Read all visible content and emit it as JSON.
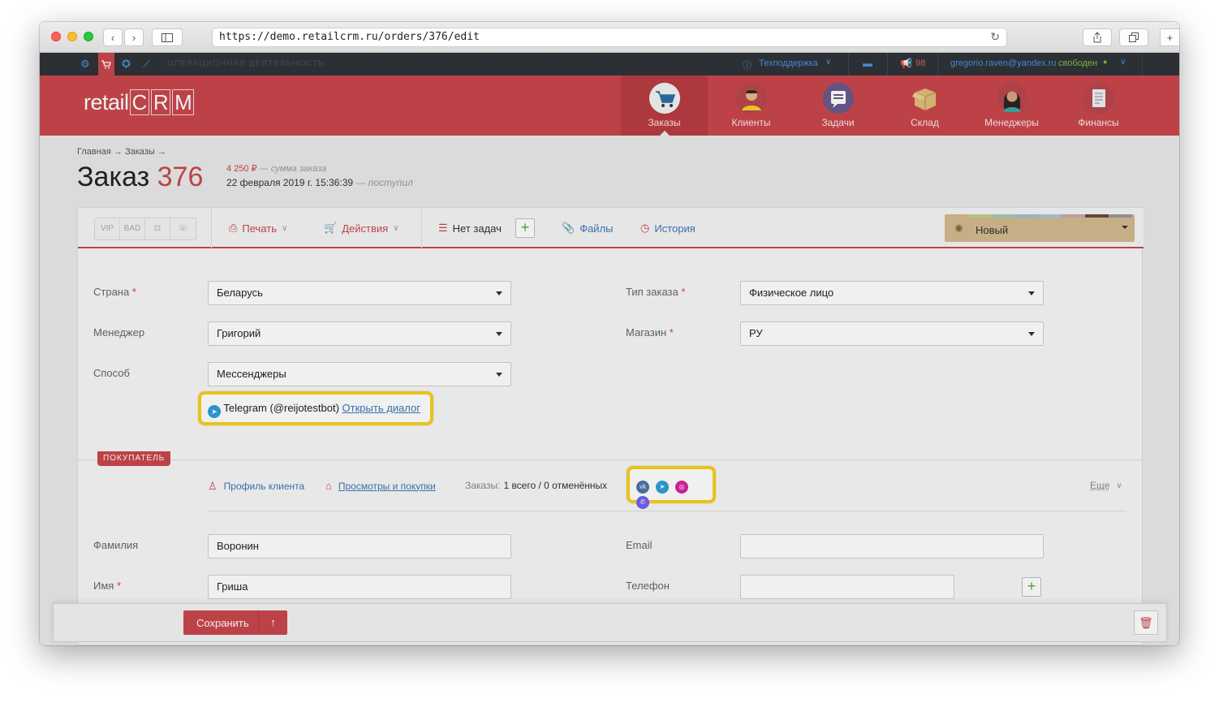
{
  "browser": {
    "url": "https://demo.retailcrm.ru/orders/376/edit",
    "back": "‹",
    "forward": "›"
  },
  "topbar": {
    "section": "ОПЕРАЦИОННАЯ ДЕЯТЕЛЬНОСТЬ",
    "support": "Техподдержка",
    "notifications": "98",
    "user_email": "gregorio.raven@yandex.ru",
    "user_status": "свободен"
  },
  "header": {
    "logo_prefix": "retail",
    "logo_letters": [
      "C",
      "R",
      "M"
    ],
    "nav": [
      {
        "label": "Заказы",
        "icon": "cart-icon"
      },
      {
        "label": "Клиенты",
        "icon": "client-avatar-icon"
      },
      {
        "label": "Задачи",
        "icon": "tasks-icon"
      },
      {
        "label": "Склад",
        "icon": "warehouse-box-icon"
      },
      {
        "label": "Менеджеры",
        "icon": "manager-avatar-icon"
      },
      {
        "label": "Финансы",
        "icon": "finance-icon"
      }
    ]
  },
  "breadcrumb": "Главная → Заказы →",
  "order": {
    "title_prefix": "Заказ",
    "number": "376",
    "sum": "4 250 ₽",
    "sum_label": "— сумма заказа",
    "date": "22 февраля 2019 г. 15:36:39",
    "date_label": "— поступил"
  },
  "toolbar": {
    "tags": [
      "VIP",
      "BAD",
      "",
      ""
    ],
    "print": "Печать",
    "actions": "Действия",
    "tasks": "Нет задач",
    "files": "Файлы",
    "history": "История",
    "status": "Новый",
    "status_strip_colors": [
      "#c7d08a",
      "#a4c9b8",
      "#9fc1cc",
      "#a9c6d6",
      "#c9a8ad",
      "#6b4a3a",
      "#9a9a9a"
    ]
  },
  "form": {
    "country_label": "Страна",
    "country": "Беларусь",
    "manager_label": "Менеджер",
    "manager": "Григорий",
    "method_label": "Способ",
    "method": "Мессенджеры",
    "order_type_label": "Тип заказа",
    "order_type": "Физическое лицо",
    "shop_label": "Магазин",
    "shop": "РУ",
    "messenger_text": "Telegram (@reijotestbot)",
    "messenger_link": "Открыть диалог"
  },
  "buyer": {
    "badge": "ПОКУПАТЕЛЬ",
    "profile": "Профиль клиента",
    "views": "Просмотры и покупки",
    "orders_label": "Заказы:",
    "orders_value": "1 всего / 0 отменённых",
    "more": "Еще",
    "socials": [
      {
        "name": "vk-icon",
        "glyph": "vk",
        "color": "#4a76a8"
      },
      {
        "name": "telegram-icon",
        "glyph": "➤",
        "color": "#2f9ed9"
      },
      {
        "name": "instagram-icon",
        "glyph": "◎",
        "color": "#d6249f"
      },
      {
        "name": "viber-icon",
        "glyph": "✆",
        "color": "#7360f2"
      }
    ],
    "lastname_label": "Фамилия",
    "lastname": "Воронин",
    "email_label": "Email",
    "email": "",
    "firstname_label": "Имя",
    "firstname": "Гриша",
    "phone_label": "Телефон",
    "phone": ""
  },
  "footer": {
    "save": "Сохранить"
  }
}
